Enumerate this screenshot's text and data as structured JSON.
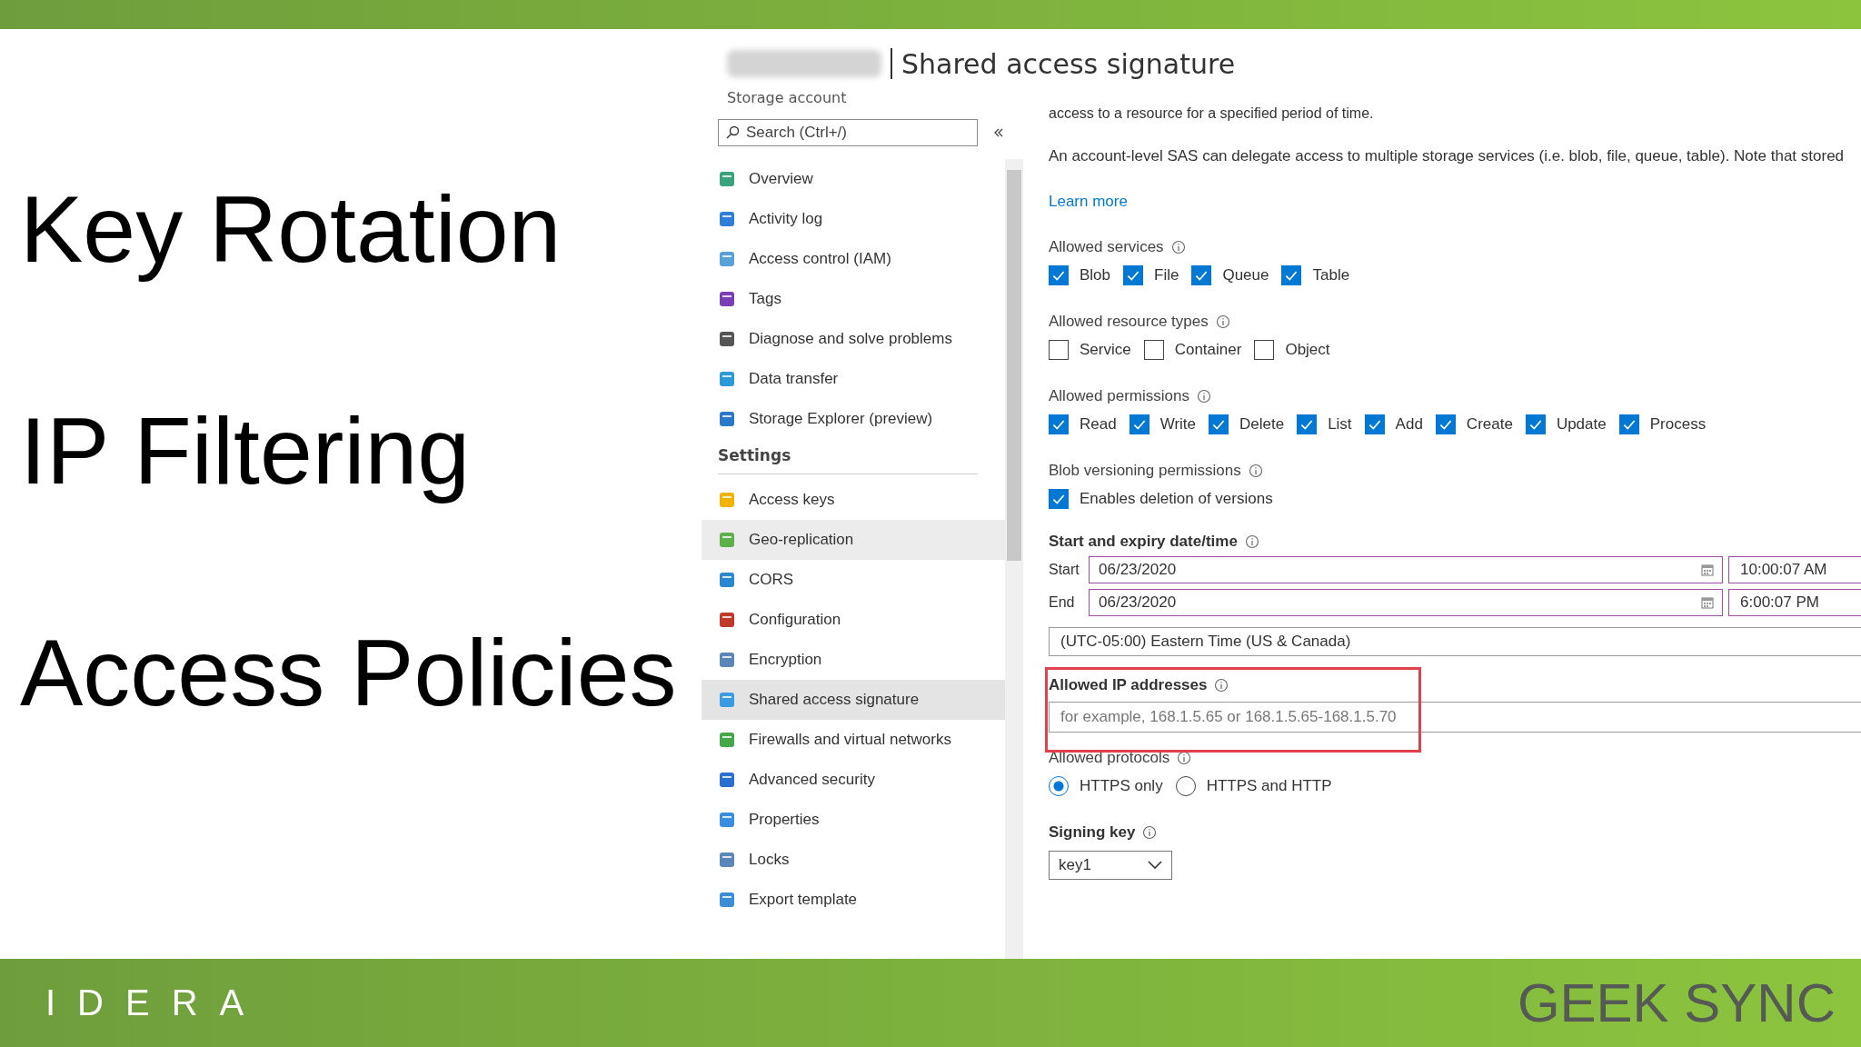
{
  "slide": {
    "topics": [
      "Key Rotation",
      "IP Filtering",
      "Access Policies"
    ],
    "logo": "IDERA",
    "brand": "GEEK SYNC"
  },
  "portal": {
    "title": "Shared access signature",
    "subtitle": "Storage account",
    "search": {
      "placeholder": "Search (Ctrl+/)"
    },
    "sidebar": [
      {
        "items": [
          {
            "label": "Overview",
            "selected": false,
            "hovered": false
          },
          {
            "label": "Activity log",
            "selected": false,
            "hovered": false
          },
          {
            "label": "Access control (IAM)",
            "selected": false,
            "hovered": false
          },
          {
            "label": "Tags",
            "selected": false,
            "hovered": false
          },
          {
            "label": "Diagnose and solve problems",
            "selected": false,
            "hovered": false
          },
          {
            "label": "Data transfer",
            "selected": false,
            "hovered": false
          },
          {
            "label": "Storage Explorer (preview)",
            "selected": false,
            "hovered": false
          }
        ]
      },
      {
        "heading": "Settings",
        "items": [
          {
            "label": "Access keys",
            "selected": false,
            "hovered": false
          },
          {
            "label": "Geo-replication",
            "selected": false,
            "hovered": true
          },
          {
            "label": "CORS",
            "selected": false,
            "hovered": false
          },
          {
            "label": "Configuration",
            "selected": false,
            "hovered": false
          },
          {
            "label": "Encryption",
            "selected": false,
            "hovered": false
          },
          {
            "label": "Shared access signature",
            "selected": true,
            "hovered": false
          },
          {
            "label": "Firewalls and virtual networks",
            "selected": false,
            "hovered": false
          },
          {
            "label": "Advanced security",
            "selected": false,
            "hovered": false
          },
          {
            "label": "Properties",
            "selected": false,
            "hovered": false
          },
          {
            "label": "Locks",
            "selected": false,
            "hovered": false
          },
          {
            "label": "Export template",
            "selected": false,
            "hovered": false
          }
        ]
      }
    ],
    "intro": [
      "access to a resource for a specified period of time.",
      "An account-level SAS can delegate access to multiple storage services (i.e. blob, file, queue, table). Note that stored"
    ],
    "learn_more": "Learn more",
    "groups": [
      {
        "label": "Allowed services",
        "options": [
          {
            "label": "Blob",
            "checked": true
          },
          {
            "label": "File",
            "checked": true
          },
          {
            "label": "Queue",
            "checked": true
          },
          {
            "label": "Table",
            "checked": true
          }
        ]
      },
      {
        "label": "Allowed resource types",
        "options": [
          {
            "label": "Service",
            "checked": false
          },
          {
            "label": "Container",
            "checked": false
          },
          {
            "label": "Object",
            "checked": false
          }
        ]
      },
      {
        "label": "Allowed permissions",
        "options": [
          {
            "label": "Read",
            "checked": true
          },
          {
            "label": "Write",
            "checked": true
          },
          {
            "label": "Delete",
            "checked": true
          },
          {
            "label": "List",
            "checked": true
          },
          {
            "label": "Add",
            "checked": true
          },
          {
            "label": "Create",
            "checked": true
          },
          {
            "label": "Update",
            "checked": true
          },
          {
            "label": "Process",
            "checked": true
          }
        ]
      },
      {
        "label": "Blob versioning permissions",
        "options": [
          {
            "label": "Enables deletion of versions",
            "checked": true
          }
        ]
      }
    ],
    "datetime": {
      "label": "Start and expiry date/time",
      "rows": [
        {
          "label": "Start",
          "date": "06/23/2020",
          "time": "10:00:07 AM"
        },
        {
          "label": "End",
          "date": "06/23/2020",
          "time": "6:00:07 PM"
        }
      ],
      "timezone": "(UTC-05:00) Eastern Time (US & Canada)"
    },
    "ip": {
      "label": "Allowed IP addresses",
      "placeholder": "for example, 168.1.5.65 or 168.1.5.65-168.1.5.70",
      "highlighted": true
    },
    "protocols": {
      "label": "Allowed protocols",
      "options": [
        {
          "label": "HTTPS only",
          "selected": true
        },
        {
          "label": "HTTPS and HTTP",
          "selected": false
        }
      ]
    },
    "signing_key": {
      "label": "Signing key",
      "value": "key1"
    }
  }
}
